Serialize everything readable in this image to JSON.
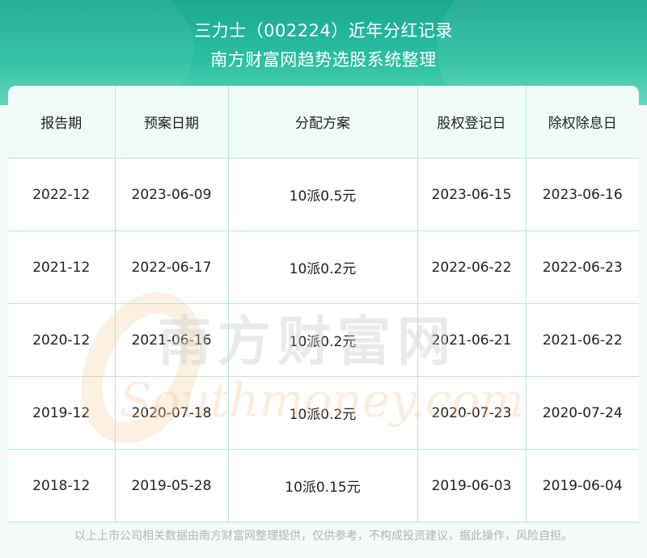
{
  "header": {
    "title": "三力士（002224）近年分红记录",
    "subtitle": "南方财富网趋势选股系统整理"
  },
  "table": {
    "columns": [
      "报告期",
      "预案日期",
      "分配方案",
      "股权登记日",
      "除权除息日"
    ],
    "rows": [
      [
        "2022-12",
        "2023-06-09",
        "10派0.5元",
        "2023-06-15",
        "2023-06-16"
      ],
      [
        "2021-12",
        "2022-06-17",
        "10派0.2元",
        "2022-06-22",
        "2022-06-23"
      ],
      [
        "2020-12",
        "2021-06-16",
        "10派0.2元",
        "2021-06-21",
        "2021-06-22"
      ],
      [
        "2019-12",
        "2020-07-18",
        "10派0.2元",
        "2020-07-23",
        "2020-07-24"
      ],
      [
        "2018-12",
        "2019-05-28",
        "10派0.15元",
        "2019-06-03",
        "2019-06-04"
      ]
    ]
  },
  "watermark": {
    "chinese": "南方财富网",
    "english": "Southmoney.com"
  },
  "footer": {
    "disclaimer": "以上上市公司相关数据由南方财富网整理提供，仅供参考，不构成投资建议，据此操作，风险自担。"
  },
  "colors": {
    "header_green": "#1aa98e",
    "grid_line": "#b9e6d9",
    "header_row_bg": "#effcf8"
  }
}
